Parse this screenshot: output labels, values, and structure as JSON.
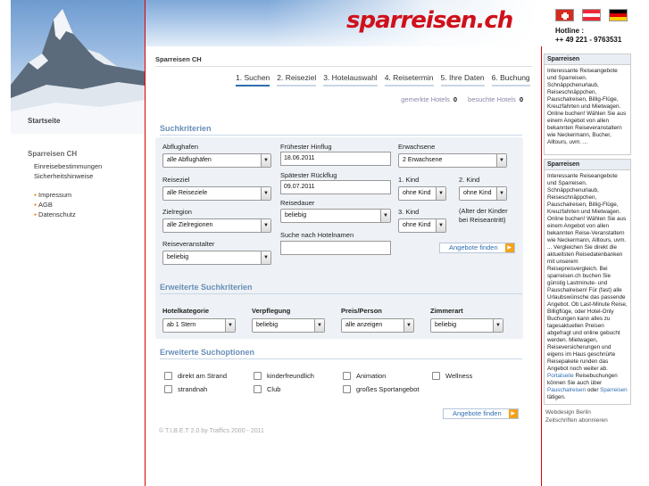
{
  "header": {
    "logo": "sparreisen.ch",
    "hotline_label": "Hotline :",
    "hotline_number": "++ 49 221 - 9763531",
    "flags": [
      "ch-flag",
      "at-flag",
      "de-flag"
    ]
  },
  "sidebar": {
    "start": "Startseite",
    "group_title": "Sparreisen CH",
    "links": [
      "Einreisebestimmungen",
      "Sicherheitshinweise"
    ],
    "bullets": [
      "Impressum",
      "AGB",
      "Datenschutz"
    ]
  },
  "main": {
    "breadcrumb": "Sparreisen CH",
    "steps": [
      "1. Suchen",
      "2. Reiseziel",
      "3. Hotelauswahl",
      "4. Reisetermin",
      "5. Ihre Daten",
      "6. Buchung"
    ],
    "memo": {
      "gemerkte_label": "gemerkte Hotels",
      "gemerkte_count": "0",
      "besuchte_label": "besuchte Hotels",
      "besuchte_count": "0"
    },
    "suchkriterien": {
      "title": "Suchkriterien",
      "abflughafen_label": "Abflughafen",
      "abflughafen_value": "alle Abflughäfen",
      "reiseziel_label": "Reiseziel",
      "reiseziel_value": "alle Reiseziele",
      "zielregion_label": "Zielregion",
      "zielregion_value": "alle Zielregionen",
      "veranstalter_label": "Reiseveranstalter",
      "veranstalter_value": "beliebig",
      "hinflug_label": "Frühester Hinflug",
      "hinflug_value": "18.06.2011",
      "rueckflug_label": "Spätester Rückflug",
      "rueckflug_value": "09.07.2011",
      "reisedauer_label": "Reisedauer",
      "reisedauer_value": "beliebig",
      "hotelname_label": "Suche nach Hotelnamen",
      "hotelname_value": "",
      "erwachsene_label": "Erwachsene",
      "erwachsene_value": "2 Erwachsene",
      "kind1_label": "1. Kind",
      "kind1_value": "ohne Kind",
      "kind2_label": "2. Kind",
      "kind2_value": "ohne Kind",
      "kind3_label": "3. Kind",
      "kind3_value": "ohne Kind",
      "kinder_hint": "(Alter der Kinder bei Reiseantritt)",
      "button": "Angebote finden"
    },
    "erweitert": {
      "title": "Erweiterte Suchkriterien",
      "hotelkategorie_label": "Hotelkategorie",
      "hotelkategorie_value": "ab 1 Stern",
      "verpflegung_label": "Verpflegung",
      "verpflegung_value": "beliebig",
      "preis_label": "Preis/Person",
      "preis_value": "alle anzeigen",
      "zimmerart_label": "Zimmerart",
      "zimmerart_value": "beliebig"
    },
    "optionen": {
      "title": "Erweiterte Suchoptionen",
      "checks": [
        "direkt am Strand",
        "kinderfreundlich",
        "Animation",
        "Wellness",
        "strandnah",
        "Club",
        "großes Sportangebot"
      ],
      "button": "Angebote finden"
    },
    "footer": "© T.I.B.E.T 2.0 by Traffics 2000 - 2011"
  },
  "right": {
    "box1_title": "Sparreisen",
    "box1_text": "Interessante Reiseangebote und Sparreisen. Schnäppchenurlaub, Reiseschnäppchen, Pauschalreisen, Billig-Flüge, Kreuzfahrten und Mietwagen. Online buchen! Wählen Sie aus einem Angebot von allen bekannten Reiseveranstaltern wie Neckermann, Bucher, Alltours, uvm. ...",
    "box2_title": "Sparreisen",
    "box2_text": "Interessante Reiseangebote und Sparreisen. Schnäppchenurlaub, Reiseschnäppchen, Pauschalreisen, Billig-Flüge, Kreuzfahrten und Mietwagen. Online buchen! Wählen Sie aus einem Angebot von allen bekannten Reise-Veranstaltern wie Neckermann, Alltours, uvm. ... Vergleichen Sie direkt die aktuellsten Reisedatenbanken mit unserem Reisepreisvergleich. Bei sparreisen.ch buchen Sie günstig Lastminute- und Pauschalreisen! Für (fast) alle Urlaubswünsche das passende Angebot. Ob Last-Minute Reise, Billigflüge, oder Hotel-Only Buchungen kann alles zu tagesaktuellen Preisen abgefragt und online gebucht werden. Mietwagen, Reiseversicherungen und eigens im Haus geschnürte Reisepakete runden das Angebot noch weiter ab.",
    "box2_link1": "Portalseite",
    "box2_text2": "Reisebuchungen können Sie auch über",
    "box2_link2": "Pauschalreisen",
    "box2_text3": "oder",
    "box2_link3": "Sparreisen",
    "box2_text4": "tätigen.",
    "foot1": "Webdesign Berlin",
    "foot2": "Zeitschriften abonnieren"
  }
}
